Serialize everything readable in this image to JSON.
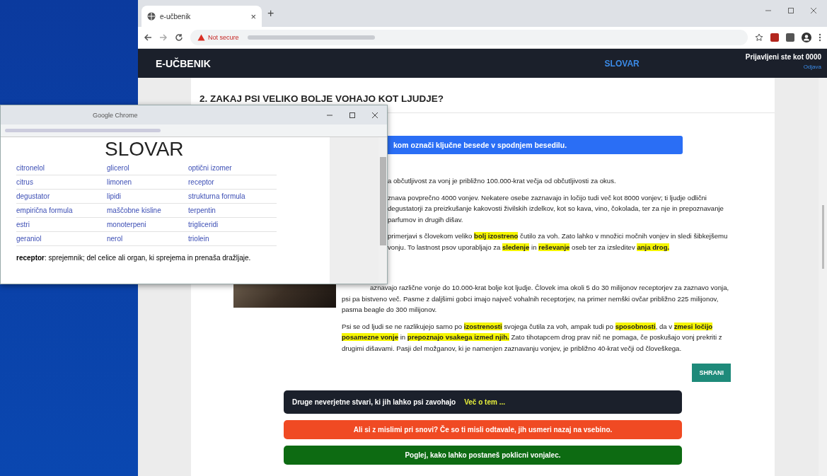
{
  "browser": {
    "tab": {
      "title": "e-učbenik",
      "close": "×"
    },
    "new_tab": "+",
    "address": {
      "security": "Not secure"
    }
  },
  "navbar": {
    "brand": "E-UČBENIK",
    "link": "SLOVAR",
    "user": "Prijavljeni ste kot 0000",
    "logout": "Odjava"
  },
  "article": {
    "heading": "2. ZAKAJ PSI VELIKO BOLJE VOHAJO KOT LJUDJE?",
    "instruction": "kom označi ključne besede v spodnjem besedilu.",
    "paragraphs": [
      {
        "kind": "covered",
        "text": "a občutljivost za vonj je približno 100.000-krat večja od občutljivosti za okus."
      },
      {
        "kind": "covered",
        "text": "znava povprečno 4000 vonjev. Nekatere osebe zaznavajo in ločijo tudi več kot 8000 vonjev; ti ljudje odlični degustatorji za preizkušanje kakovosti živilskih izdelkov, kot so kava, vino, čokolada, ter za nje in prepoznavanje parfumov in drugih dišav."
      },
      {
        "kind": "covered",
        "text": "primerjavi s človekom veliko **bolj izostreno** čutilo za voh. Zato lahko v množici močnih vonjev in sledi šibkejšemu vonju. To lastnost psov uporabljajo za **sledenje** in **reševanje** oseb ter za izsleditev **anja drog.**"
      },
      {
        "kind": "partly",
        "text": "aznavajo različne vonje do 10.000-krat bolje kot ljudje. Človek ima okoli 5 do 30 milijonov receptorjev za zaznavo vonja, psi pa bistveno več. Pasme z daljšimi gobci imajo največ vohalnih receptorjev, na primer nemški ovčar približno 225 milijonov, pasma beagle do 300 milijonov."
      },
      {
        "kind": "full",
        "text": "Psi se od ljudi se ne razlikujejo samo po **izostrenosti** svojega čutila za voh, ampak tudi po **sposobnosti**, da v **zmesi ločijo posamezne vonje** in **prepoznajo vsakega izmed njih.** Zato tihotapcem drog prav nič ne pomaga, če poskušajo vonj prekriti z drugimi dišavami. Pasji del možganov, ki je namenjen zaznavanju vonjev, je približno 40-krat večji od človeškega."
      }
    ],
    "save_button": "SHRANI",
    "banners": [
      {
        "kind": "link",
        "text": "Druge neverjetne stvari, ki jih lahko psi zavohajo",
        "link": "Več o tem ..."
      },
      {
        "kind": "warning",
        "text": "Ali si z mislimi pri snovi? Če so ti misli odtavale, jih usmeri nazaj na vsebino."
      },
      {
        "kind": "info",
        "text": "Poglej, kako lahko postaneš poklicni vonjalec."
      }
    ]
  },
  "popup": {
    "title": "Google Chrome",
    "heading": "SLOVAR",
    "terms": [
      "citronelol",
      "glicerol",
      "optični izomer",
      "citrus",
      "limonen",
      "receptor",
      "degustator",
      "lipidi",
      "strukturna formula",
      "empirična formula",
      "maščobne kisline",
      "terpentin",
      "estri",
      "monoterpeni",
      "trigliceridi",
      "geraniol",
      "nerol",
      "triolein"
    ],
    "definition": "**receptor**: sprejemnik; del celice ali organ, ki sprejema in prenaša dražljaje."
  }
}
